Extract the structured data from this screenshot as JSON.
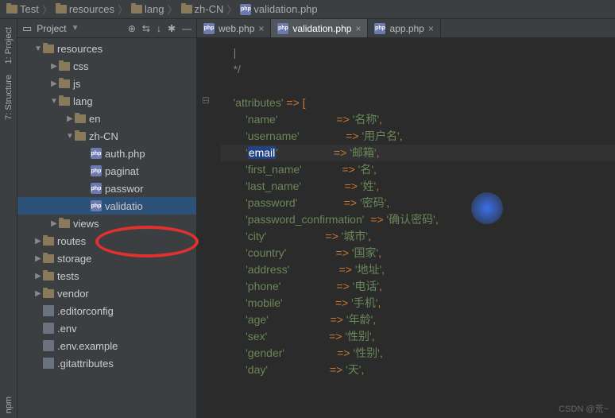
{
  "breadcrumb": [
    {
      "type": "folder",
      "label": "Test"
    },
    {
      "type": "folder",
      "label": "resources"
    },
    {
      "type": "folder",
      "label": "lang"
    },
    {
      "type": "folder",
      "label": "zh-CN"
    },
    {
      "type": "php",
      "label": "validation.php"
    }
  ],
  "sidebar_tabs": {
    "project": "1: Project",
    "structure": "7: Structure",
    "npm": "npm"
  },
  "panel": {
    "title": "Project"
  },
  "tree": [
    {
      "indent": 2,
      "arrow": "expanded",
      "icon": "folder",
      "label": "resources"
    },
    {
      "indent": 4,
      "arrow": "collapsed",
      "icon": "folder",
      "label": "css"
    },
    {
      "indent": 4,
      "arrow": "collapsed",
      "icon": "folder",
      "label": "js"
    },
    {
      "indent": 4,
      "arrow": "expanded",
      "icon": "folder",
      "label": "lang"
    },
    {
      "indent": 6,
      "arrow": "collapsed",
      "icon": "folder",
      "label": "en"
    },
    {
      "indent": 6,
      "arrow": "expanded",
      "icon": "folder",
      "label": "zh-CN"
    },
    {
      "indent": 8,
      "arrow": "none",
      "icon": "php",
      "label": "auth.php"
    },
    {
      "indent": 8,
      "arrow": "none",
      "icon": "php",
      "label": "paginat"
    },
    {
      "indent": 8,
      "arrow": "none",
      "icon": "php",
      "label": "passwor"
    },
    {
      "indent": 8,
      "arrow": "none",
      "icon": "php",
      "label": "validatio",
      "selected": true
    },
    {
      "indent": 4,
      "arrow": "collapsed",
      "icon": "folder",
      "label": "views"
    },
    {
      "indent": 2,
      "arrow": "collapsed",
      "icon": "folder",
      "label": "routes"
    },
    {
      "indent": 2,
      "arrow": "collapsed",
      "icon": "folder",
      "label": "storage"
    },
    {
      "indent": 2,
      "arrow": "collapsed",
      "icon": "folder",
      "label": "tests"
    },
    {
      "indent": 2,
      "arrow": "collapsed",
      "icon": "folder",
      "label": "vendor"
    },
    {
      "indent": 2,
      "arrow": "none",
      "icon": "file",
      "label": ".editorconfig"
    },
    {
      "indent": 2,
      "arrow": "none",
      "icon": "file",
      "label": ".env"
    },
    {
      "indent": 2,
      "arrow": "none",
      "icon": "file",
      "label": ".env.example"
    },
    {
      "indent": 2,
      "arrow": "none",
      "icon": "file",
      "label": ".gitattributes"
    }
  ],
  "tabs": [
    {
      "icon": "php",
      "label": "web.php",
      "active": false
    },
    {
      "icon": "php",
      "label": "validation.php",
      "active": true
    },
    {
      "icon": "php",
      "label": "app.php",
      "active": false
    }
  ],
  "code": {
    "comment_end": "*/",
    "attributes_key": "'attributes'",
    "arrow": "=>",
    "open_bracket": "[",
    "entries": [
      {
        "key": "'name'",
        "val": "'名称'"
      },
      {
        "key": "'username'",
        "val": "'用户名'"
      },
      {
        "key": "'email'",
        "val": "'邮箱'",
        "current": true,
        "selected": true
      },
      {
        "key": "'first_name'",
        "val": "'名'"
      },
      {
        "key": "'last_name'",
        "val": "'姓'"
      },
      {
        "key": "'password'",
        "val": "'密码'"
      },
      {
        "key": "'password_confirmation'",
        "val": "'确认密码'"
      },
      {
        "key": "'city'",
        "val": "'城市'"
      },
      {
        "key": "'country'",
        "val": "'国家'"
      },
      {
        "key": "'address'",
        "val": "'地址'"
      },
      {
        "key": "'phone'",
        "val": "'电话'"
      },
      {
        "key": "'mobile'",
        "val": "'手机'"
      },
      {
        "key": "'age'",
        "val": "'年龄'"
      },
      {
        "key": "'sex'",
        "val": "'性别'"
      },
      {
        "key": "'gender'",
        "val": "'性别'"
      },
      {
        "key": "'day'",
        "val": "'天'"
      }
    ]
  },
  "watermark": "CSDN @荒~"
}
